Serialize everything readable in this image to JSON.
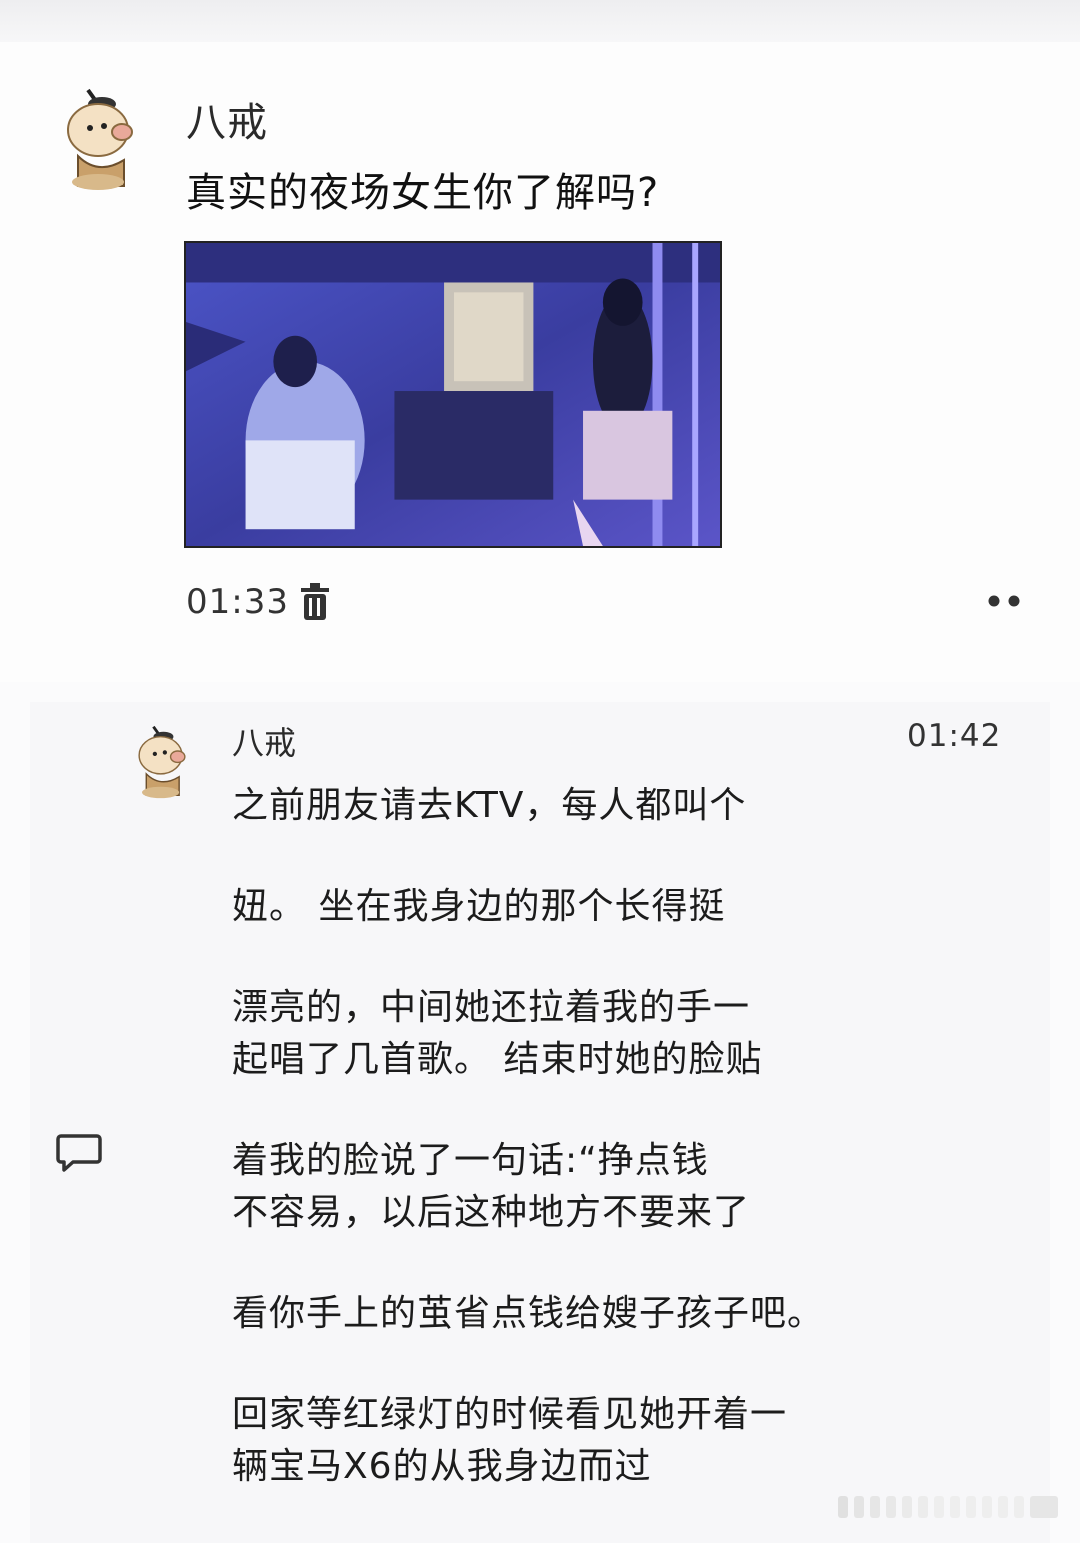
{
  "post": {
    "author": "八戒",
    "text": "真实的夜场女生你了解吗?",
    "duration": "01:33",
    "delete_icon": "trash-icon",
    "more_icon": "more-dots-icon"
  },
  "comment": {
    "author": "八戒",
    "time": "01:42",
    "lines": [
      "之前朋友请去KTV，每人都叫个",
      "妞。 坐在我身边的那个长得挺",
      "漂亮的，中间她还拉着我的手一",
      "起唱了几首歌。 结束时她的脸贴",
      "着我的脸说了一句话:“挣点钱",
      "不容易，以后这种地方不要来了",
      "看你手上的茧省点钱给嫂子孩子吧。",
      "回家等红绿灯的时候看见她开着一",
      "辆宝马X6的从我身边而过"
    ],
    "comment_icon": "comment-bubble-icon"
  }
}
